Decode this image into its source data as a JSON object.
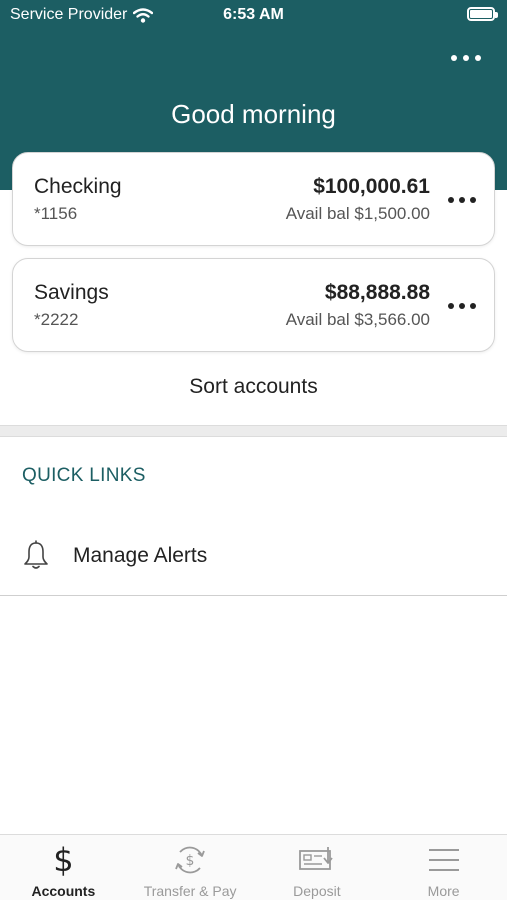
{
  "status_bar": {
    "carrier": "Service Provider",
    "time": "6:53 AM"
  },
  "header": {
    "greeting": "Good morning",
    "more_icon": "ellipsis-icon"
  },
  "accounts": [
    {
      "name": "Checking",
      "number": "*1156",
      "balance": "$100,000.61",
      "available": "Avail bal $1,500.00"
    },
    {
      "name": "Savings",
      "number": "*2222",
      "balance": "$88,888.88",
      "available": "Avail bal $3,566.00"
    }
  ],
  "sort_accounts_label": "Sort accounts",
  "quick_links": {
    "title": "QUICK LINKS",
    "items": [
      {
        "label": "Manage Alerts",
        "icon": "bell-icon"
      }
    ]
  },
  "tabs": [
    {
      "label": "Accounts",
      "icon": "dollar-icon",
      "active": true
    },
    {
      "label": "Transfer & Pay",
      "icon": "transfer-icon",
      "active": false
    },
    {
      "label": "Deposit",
      "icon": "check-deposit-icon",
      "active": false
    },
    {
      "label": "More",
      "icon": "menu-icon",
      "active": false
    }
  ],
  "colors": {
    "header_bg": "#1c5e63",
    "accent": "#1c5e63",
    "inactive_tab": "#9a9a9a"
  }
}
